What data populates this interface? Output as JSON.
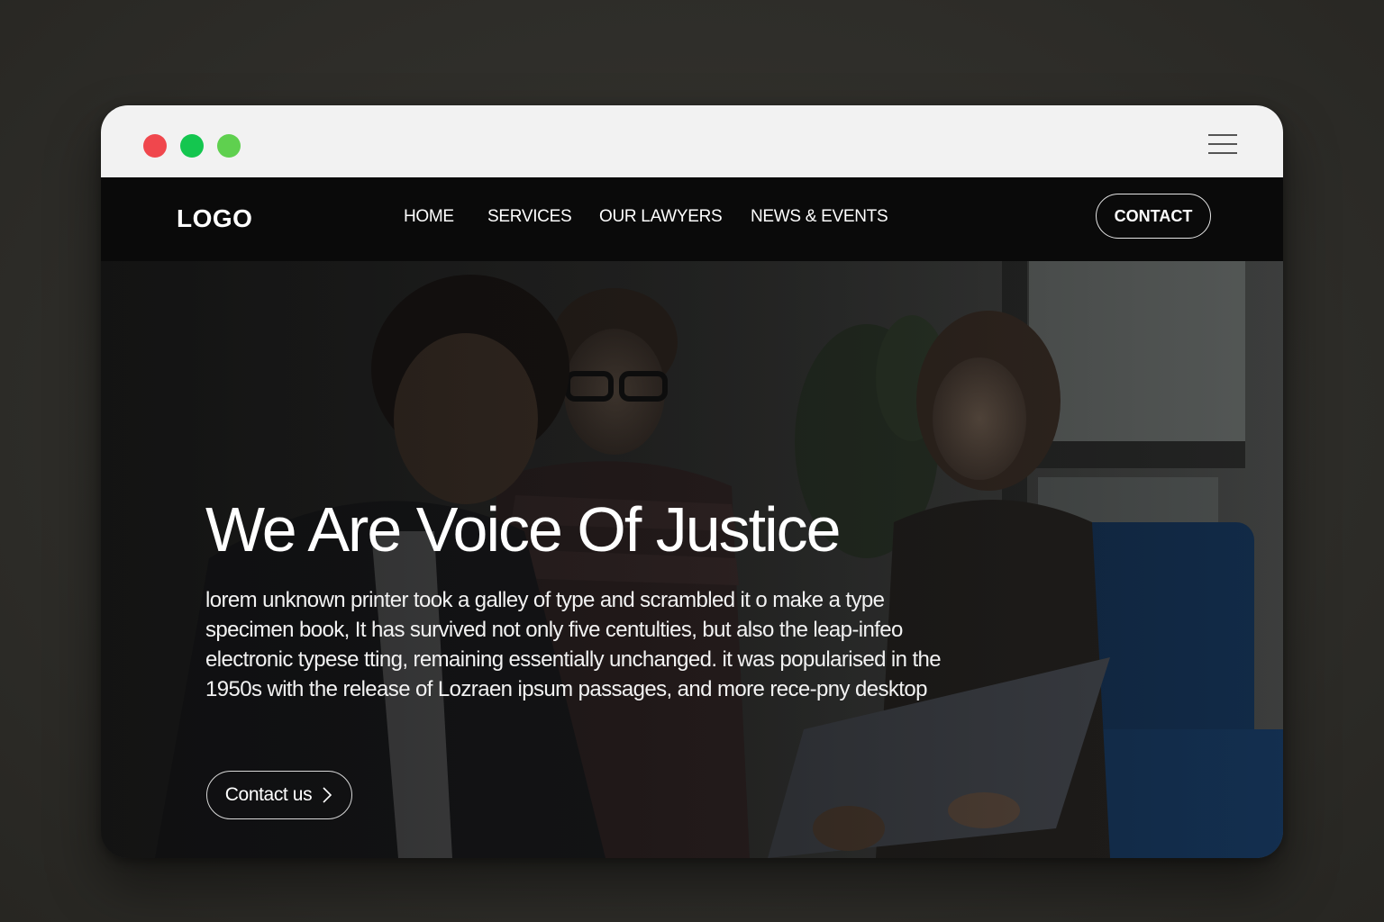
{
  "window": {
    "controls": [
      "close",
      "minimize",
      "maximize"
    ],
    "menu_icon": "hamburger-menu-icon"
  },
  "navbar": {
    "logo": "LOGO",
    "links": [
      "HOME",
      "SERVICES",
      "OUR LAWYERS",
      "NEWS & EVENTS"
    ],
    "contact_label": "CONTACT"
  },
  "hero": {
    "title": "We Are Voice Of Justice",
    "body": "lorem unknown printer took a galley of type and scrambled it o make a type specimen book, It has survived not only five centulties, but also the leap-infeo electronic typese tting, remaining essentially unchanged. it was popularised in the 1950s with the release of Lozraen ipsum passages, and more rece-pny desktop",
    "cta_label": "Contact us",
    "cta_icon": "chevron-right-icon"
  },
  "colors": {
    "background": "#2f2e2b",
    "titlebar": "#f2f2f2",
    "navbar": "#0a0a0a",
    "close_dot": "#f0474d",
    "minimize_dot": "#14c64f",
    "maximize_dot": "#5fd04f",
    "text": "#ffffff"
  }
}
